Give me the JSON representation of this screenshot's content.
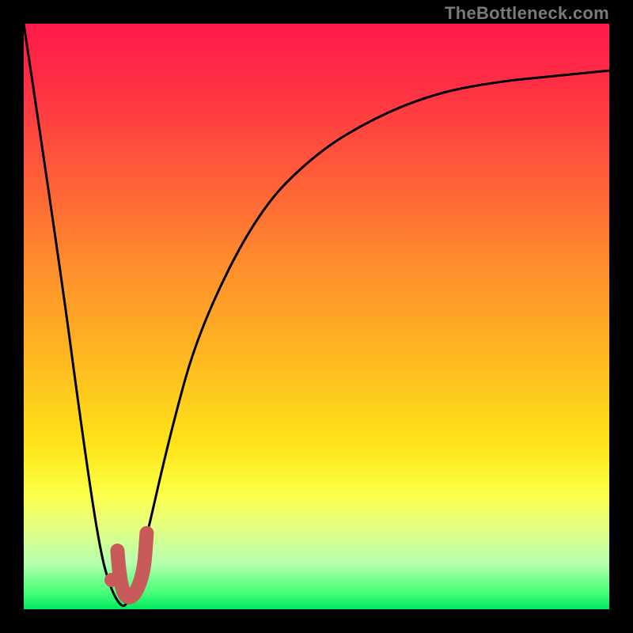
{
  "watermark": "TheBottleneck.com",
  "colors": {
    "background": "#000000",
    "gradient_top": "#ff1a4b",
    "gradient_mid": "#ffe419",
    "gradient_bottom": "#00e85e",
    "curve": "#000000",
    "marker": "#c85a5a"
  },
  "chart_data": {
    "type": "line",
    "title": "",
    "xlabel": "",
    "ylabel": "",
    "xlim": [
      0,
      100
    ],
    "ylim": [
      0,
      100
    ],
    "series": [
      {
        "name": "bottleneck-curve",
        "x": [
          0,
          6,
          10,
          13,
          15,
          17,
          18,
          20,
          25,
          30,
          40,
          50,
          60,
          70,
          80,
          90,
          100
        ],
        "values": [
          100,
          60,
          30,
          10,
          3,
          0,
          2,
          8,
          30,
          48,
          68,
          78,
          84,
          88,
          90,
          91,
          92
        ]
      }
    ],
    "optimum_x": 17,
    "marker": {
      "dot": {
        "x": 15,
        "y": 5
      },
      "hook": [
        {
          "x": 16,
          "y": 10
        },
        {
          "x": 16.5,
          "y": 3
        },
        {
          "x": 18.5,
          "y": 1.5
        },
        {
          "x": 20.5,
          "y": 6
        },
        {
          "x": 21,
          "y": 13
        }
      ]
    }
  }
}
